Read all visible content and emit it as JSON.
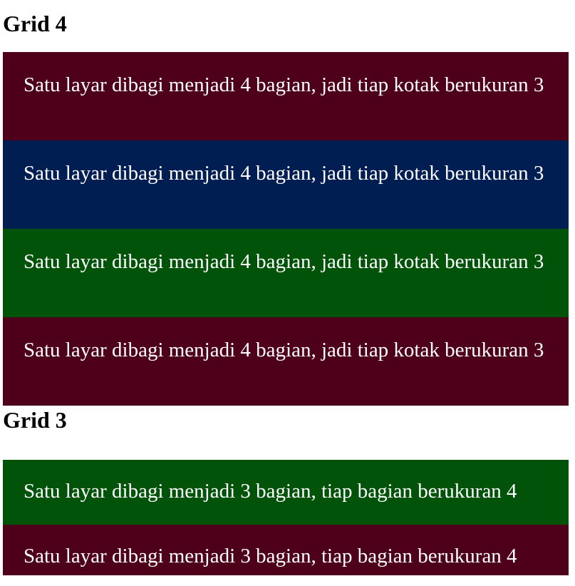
{
  "colors": {
    "maroon": "#4e001b",
    "navy": "#001e52",
    "green": "#005308"
  },
  "grid4": {
    "title": "Grid 4",
    "items": [
      {
        "text": "Satu layar dibagi menjadi 4 bagian, jadi tiap kotak berukuran 3"
      },
      {
        "text": "Satu layar dibagi menjadi 4 bagian, jadi tiap kotak berukuran 3"
      },
      {
        "text": "Satu layar dibagi menjadi 4 bagian, jadi tiap kotak berukuran 3"
      },
      {
        "text": "Satu layar dibagi menjadi 4 bagian, jadi tiap kotak berukuran 3"
      }
    ]
  },
  "grid3": {
    "title": "Grid 3",
    "items": [
      {
        "text": "Satu layar dibagi menjadi 3 bagian, tiap bagian berukuran 4"
      },
      {
        "text": "Satu layar dibagi menjadi 3 bagian, tiap bagian berukuran 4"
      }
    ]
  }
}
